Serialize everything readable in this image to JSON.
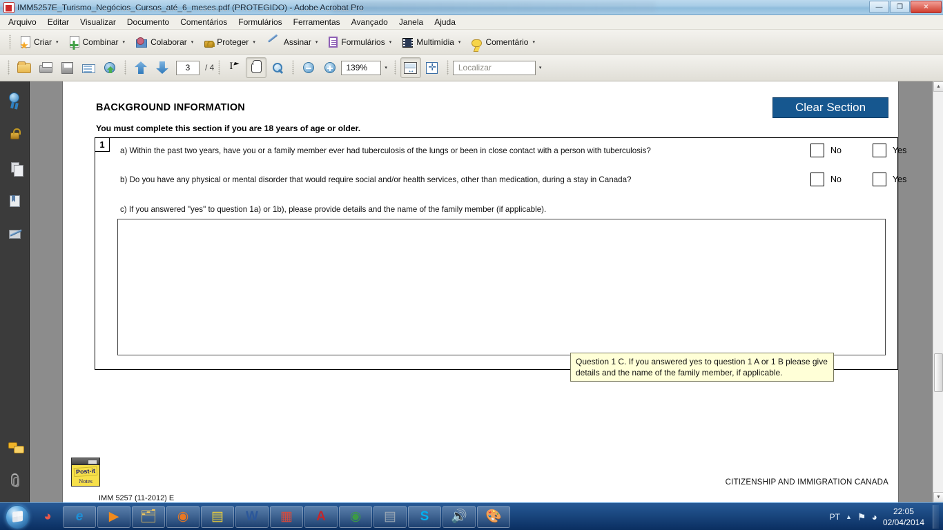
{
  "window": {
    "title": "IMM5257E_Turismo_Negócios_Cursos_até_6_meses.pdf (PROTEGIDO) - Adobe Acrobat Pro",
    "app_icon": "pdf-icon",
    "minimize_label": "—",
    "maximize_label": "❐",
    "close_label": "✕"
  },
  "menubar": {
    "items": [
      {
        "label": "Arquivo"
      },
      {
        "label": "Editar"
      },
      {
        "label": "Visualizar"
      },
      {
        "label": "Documento"
      },
      {
        "label": "Comentários"
      },
      {
        "label": "Formulários"
      },
      {
        "label": "Ferramentas"
      },
      {
        "label": "Avançado"
      },
      {
        "label": "Janela"
      },
      {
        "label": "Ajuda"
      }
    ]
  },
  "toolbar_main": {
    "buttons": [
      {
        "label": "Criar",
        "icon": "create-document-icon",
        "caret": "▾"
      },
      {
        "label": "Combinar",
        "icon": "combine-files-icon",
        "caret": "▾"
      },
      {
        "label": "Colaborar",
        "icon": "collaborate-icon",
        "caret": "▾"
      },
      {
        "label": "Proteger",
        "icon": "lock-icon",
        "caret": "▾"
      },
      {
        "label": "Assinar",
        "icon": "pen-icon",
        "caret": "▾"
      },
      {
        "label": "Formulários",
        "icon": "forms-icon",
        "caret": "▾"
      },
      {
        "label": "Multimídia",
        "icon": "multimedia-icon",
        "caret": "▾"
      },
      {
        "label": "Comentário",
        "icon": "comment-icon",
        "caret": "▾"
      }
    ]
  },
  "toolbar_nav": {
    "open_icon": "open-folder-icon",
    "print_icon": "print-icon",
    "save_icon": "save-icon",
    "email_icon": "email-icon",
    "web_icon": "globe-upload-icon",
    "prev_page_icon": "arrow-up-icon",
    "next_page_icon": "arrow-down-icon",
    "page_number": "3",
    "page_total": "/ 4",
    "select_tool_icon": "select-text-icon",
    "hand_tool_icon": "hand-tool-icon",
    "marquee_zoom_icon": "marquee-zoom-icon",
    "zoom_out_icon": "zoom-out-icon",
    "zoom_in_icon": "zoom-in-icon",
    "zoom_value": "139%",
    "zoom_caret": "▾",
    "fit_width_icon": "fit-width-icon",
    "fit_page_icon": "fit-page-icon",
    "find_placeholder": "Localizar",
    "find_value": "",
    "find_caret": "▾"
  },
  "left_nav": {
    "items": [
      {
        "name": "signatures-panel",
        "icon": "signature-badge-icon"
      },
      {
        "name": "security-panel",
        "icon": "lock-icon"
      },
      {
        "name": "pages-panel",
        "icon": "pages-icon"
      },
      {
        "name": "bookmarks-panel",
        "icon": "bookmark-icon"
      },
      {
        "name": "sign-panel",
        "icon": "sign-here-icon"
      },
      {
        "name": "comments-panel",
        "icon": "comments-icon"
      },
      {
        "name": "attachments-panel",
        "icon": "paperclip-icon"
      }
    ]
  },
  "document": {
    "section_title": "BACKGROUND INFORMATION",
    "section_subtitle": "You must complete this section if you are 18 years of age or older.",
    "clear_button": "Clear Section",
    "question_number": "1",
    "question_a": "a) Within the past two years, have you or a family member ever had tuberculosis of the lungs or been in close contact with a person with tuberculosis?",
    "question_b": "b) Do you have any physical or mental disorder that would require social and/or health services, other than medication, during a stay in Canada?",
    "question_c": "c) If you answered \"yes\" to question 1a) or 1b), please provide details and the name of the family member (if applicable).",
    "answer_value": "",
    "checkbox_no_label": "No",
    "checkbox_yes_label": "Yes",
    "tooltip_text": "Question 1 C. If you answered yes to question 1 A or 1 B please give details and the name of the family member, if applicable.",
    "form_code": "IMM 5257 (11-2012) E",
    "footer_right": "CITIZENSHIP AND IMMIGRATION CANADA",
    "postit_logo": "Post-it",
    "postit_sub": "Notes",
    "accent_color": "#16578f"
  },
  "scrollbar": {
    "up_arrow": "▲",
    "down_arrow": "▼"
  },
  "taskbar": {
    "start_label": "start-orb",
    "items": [
      {
        "name": "taskbar-item-antivirus",
        "icon": "antivirus-icon",
        "glyph": "◕"
      },
      {
        "name": "taskbar-item-internet-explorer",
        "icon": "internet-explorer-icon",
        "glyph": "e"
      },
      {
        "name": "taskbar-item-media-player",
        "icon": "media-player-icon",
        "glyph": "▶"
      },
      {
        "name": "taskbar-item-explorer",
        "icon": "file-explorer-icon",
        "glyph": "🗂"
      },
      {
        "name": "taskbar-item-firefox",
        "icon": "firefox-icon",
        "glyph": "◉"
      },
      {
        "name": "taskbar-item-postit",
        "icon": "postit-notes-icon",
        "glyph": "▤"
      },
      {
        "name": "taskbar-item-word",
        "icon": "microsoft-word-icon",
        "glyph": "W"
      },
      {
        "name": "taskbar-item-apps",
        "icon": "app-grid-icon",
        "glyph": "▦"
      },
      {
        "name": "taskbar-item-acrobat",
        "icon": "adobe-acrobat-icon",
        "glyph": "A"
      },
      {
        "name": "taskbar-item-chrome",
        "icon": "google-chrome-icon",
        "glyph": "◉"
      },
      {
        "name": "taskbar-item-calculator",
        "icon": "calculator-icon",
        "glyph": "▤"
      },
      {
        "name": "taskbar-item-skype",
        "icon": "skype-icon",
        "glyph": "S"
      },
      {
        "name": "taskbar-item-volume-app",
        "icon": "speaker-icon",
        "glyph": "🔊"
      },
      {
        "name": "taskbar-item-paint",
        "icon": "paint-icon",
        "glyph": "🎨"
      }
    ],
    "tray": {
      "language": "PT",
      "caret": "▲",
      "flag_icon": "flag-alert-icon",
      "network_icon": "network-icon",
      "time": "22:05",
      "date": "02/04/2014"
    }
  }
}
